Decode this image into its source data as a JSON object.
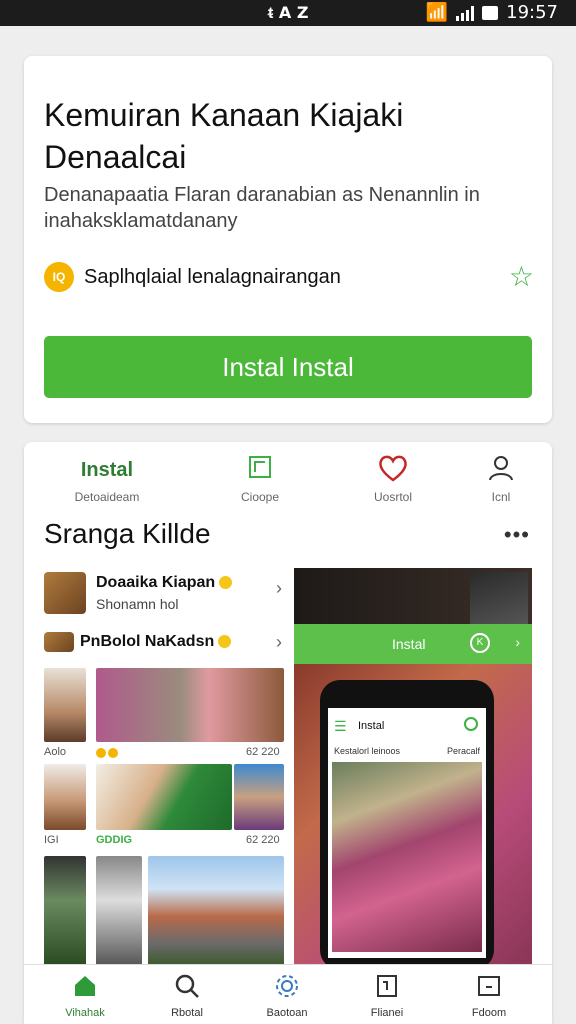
{
  "status_bar": {
    "left_text": "ᵵ A Z",
    "time": "19:57"
  },
  "app": {
    "title": "Kemuiran Kanaan Kiajaki Denaalcai",
    "description": "Denanapaatia Flaran daranabian as Nenannlin in inahaksklamatdanany",
    "developer_badge": "IQ",
    "developer": "Saplhqlaial lenalagnairangan",
    "install_label": "Instal Instal",
    "accent_color": "#4cb83a"
  },
  "tabs": [
    {
      "main": "Instal",
      "label": "Detoaideam"
    },
    {
      "icon": "image-icon",
      "label": "Cioope"
    },
    {
      "icon": "heart-icon",
      "label": "Uosrtol"
    },
    {
      "icon": "person-icon",
      "label": "Icnl"
    }
  ],
  "section": {
    "title": "Sranga Killde",
    "more": "•••"
  },
  "feed": {
    "item1": {
      "name": "Doaaika Kiapan",
      "sub": "Shonamn hol"
    },
    "item2": {
      "name": "PnBolol NaKadsn"
    },
    "captions": [
      "Aolo",
      "62 220",
      "IGI",
      "GDDIG",
      "62 220"
    ]
  },
  "promo": {
    "bar_label": "Instal",
    "phone_title": "Instal",
    "phone_sub_left": "Kestalorl leinoos",
    "phone_sub_right": "Peracalf"
  },
  "bottom_nav": [
    {
      "icon": "home-icon",
      "label": "Vihahak"
    },
    {
      "icon": "search-icon",
      "label": "Rbotal"
    },
    {
      "icon": "settings-icon",
      "label": "Baotoan"
    },
    {
      "icon": "device-icon",
      "label": "Flianei"
    },
    {
      "icon": "window-icon",
      "label": "Fdoom"
    }
  ]
}
